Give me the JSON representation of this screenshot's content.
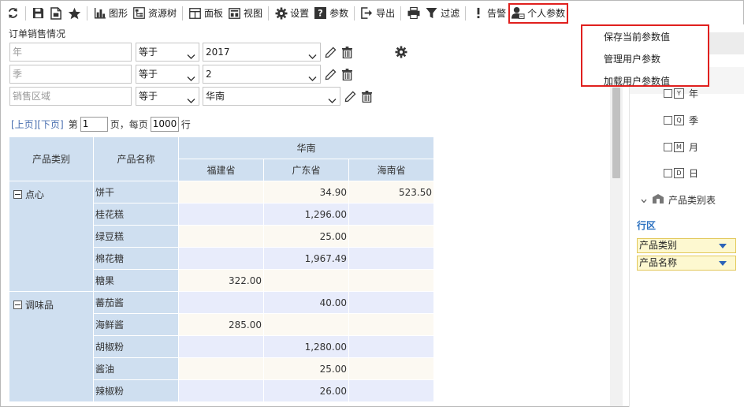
{
  "toolbar": {
    "items": [
      {
        "label": "",
        "icon": "refresh-icon"
      },
      {
        "label": "",
        "icon": "save-icon"
      },
      {
        "label": "",
        "icon": "save-as-icon"
      },
      {
        "label": "",
        "icon": "star-icon"
      },
      {
        "label": "图形",
        "icon": "bar-chart-icon"
      },
      {
        "label": "资源树",
        "icon": "tree-icon"
      },
      {
        "label": "面板",
        "icon": "panel-icon"
      },
      {
        "label": "视图",
        "icon": "view-icon"
      },
      {
        "label": "设置",
        "icon": "gear-icon"
      },
      {
        "label": "参数",
        "icon": "help-icon"
      },
      {
        "label": "导出",
        "icon": "export-icon"
      },
      {
        "label": "",
        "icon": "printer-icon"
      },
      {
        "label": "过滤",
        "icon": "filter-icon"
      },
      {
        "label": "告警",
        "icon": "alert-icon"
      },
      {
        "label": "个人参数",
        "icon": "user-params-icon"
      }
    ]
  },
  "dropdown": {
    "items": [
      "保存当前参数值",
      "管理用户参数",
      "加载用户参数值"
    ]
  },
  "report": {
    "title": "订单销售情况"
  },
  "params": [
    {
      "field": "年",
      "operator": "等于",
      "value": "2017"
    },
    {
      "field": "季",
      "operator": "等于",
      "value": "2"
    },
    {
      "field": "销售区域",
      "operator": "等于",
      "value": "华南"
    }
  ],
  "paging": {
    "prev": "[上页]",
    "next": "[下页]",
    "page_prefix": "第",
    "page_value": "1",
    "page_suffix": "页，每页",
    "per_page_value": "1000",
    "per_page_suffix": "行"
  },
  "table": {
    "col_category": "产品类别",
    "col_product": "产品名称",
    "region": "华南",
    "provinces": [
      "福建省",
      "广东省",
      "海南省"
    ],
    "groups": [
      {
        "category": "点心",
        "rows": [
          {
            "product": "饼干",
            "values": [
              "",
              "34.90",
              "523.50"
            ]
          },
          {
            "product": "桂花糕",
            "values": [
              "",
              "1,296.00",
              ""
            ]
          },
          {
            "product": "绿豆糕",
            "values": [
              "",
              "25.00",
              ""
            ]
          },
          {
            "product": "棉花糖",
            "values": [
              "",
              "1,967.49",
              ""
            ]
          },
          {
            "product": "糖果",
            "values": [
              "322.00",
              "",
              ""
            ]
          }
        ]
      },
      {
        "category": "调味品",
        "rows": [
          {
            "product": "蕃茄酱",
            "values": [
              "",
              "40.00",
              ""
            ]
          },
          {
            "product": "海鲜酱",
            "values": [
              "285.00",
              "",
              ""
            ]
          },
          {
            "product": "胡椒粉",
            "values": [
              "",
              "1,280.00",
              ""
            ]
          },
          {
            "product": "酱油",
            "values": [
              "",
              "25.00",
              ""
            ]
          },
          {
            "product": "辣椒粉",
            "values": [
              "",
              "26.00",
              ""
            ]
          }
        ]
      }
    ]
  },
  "right_panel": {
    "date_items": [
      {
        "label": "年",
        "glyph": "Y"
      },
      {
        "label": "季",
        "glyph": "Q"
      },
      {
        "label": "月",
        "glyph": "M"
      },
      {
        "label": "日",
        "glyph": "D"
      }
    ],
    "table_node": "产品类别表",
    "row_area_title": "行区",
    "row_fields": [
      "产品类别",
      "产品名称"
    ]
  },
  "colors": {
    "accent_red": "#e0201e",
    "header_blue": "#cfdff0",
    "row_alt": "#e8ecfb",
    "row_plain": "#fcf9f2",
    "region_title": "#2b71c0"
  }
}
